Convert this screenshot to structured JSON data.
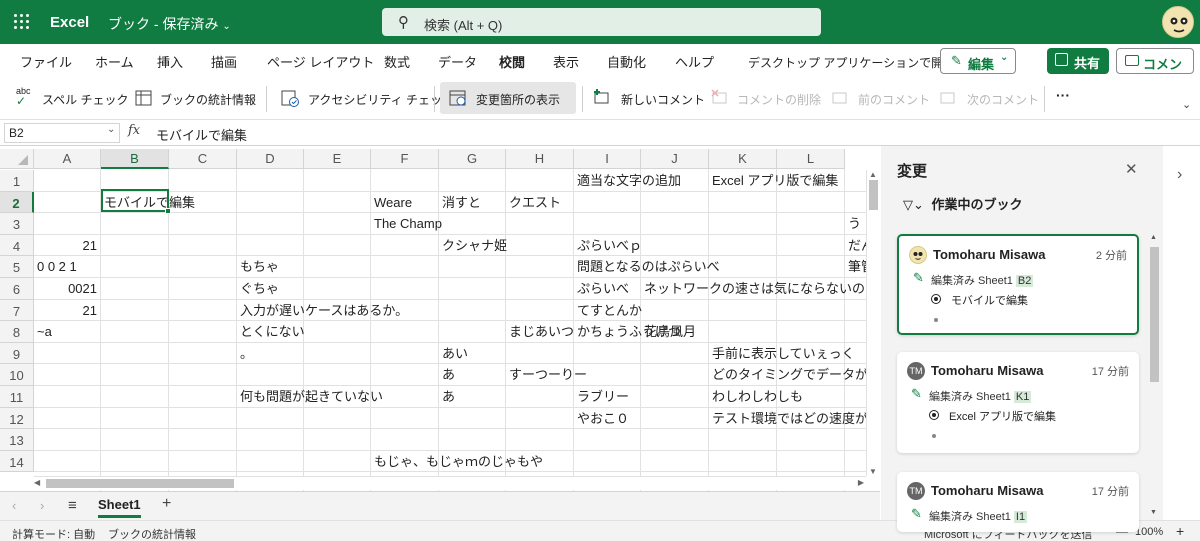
{
  "titlebar": {
    "app_name": "Excel",
    "doc_name": "ブック - 保存済み",
    "search_placeholder": "検索 (Alt + Q)"
  },
  "menu": {
    "tabs": [
      "ファイル",
      "ホーム",
      "挿入",
      "描画",
      "ページ レイアウト",
      "数式",
      "データ",
      "校閲",
      "表示",
      "自動化",
      "ヘルプ",
      "デスクトップ アプリケーションで開く"
    ],
    "active": "校閲",
    "edit_label": "編集",
    "share_label": "共有",
    "comment_label": "コメント"
  },
  "ribbon": {
    "spelling": "スペル チェック",
    "workbook_stats": "ブックの統計情報",
    "accessibility": "アクセシビリティ チェック",
    "show_changes": "変更箇所の表示",
    "new_comment": "新しいコメント",
    "delete_comment": "コメントの削除",
    "prev_comment": "前のコメント",
    "next_comment": "次のコメント",
    "more": "···"
  },
  "formula_bar": {
    "name_box": "B2",
    "fx": "fx",
    "content": "モバイルで編集"
  },
  "grid": {
    "columns": [
      "A",
      "B",
      "C",
      "D",
      "E",
      "F",
      "G",
      "H",
      "I",
      "J",
      "K",
      "L"
    ],
    "rows": [
      "1",
      "2",
      "3",
      "4",
      "5",
      "6",
      "7",
      "8",
      "9",
      "10",
      "11",
      "12",
      "13",
      "14"
    ],
    "cells": {
      "I1": "適当な文字の追加",
      "K1": "Excel アプリ版で編集",
      "B2": "モバイルで編集",
      "F2": "Weare",
      "G2": "消すと",
      "H2": "クエスト",
      "F3": "The Champ",
      "M3": "う",
      "A4": "21",
      "G4": "クシャナ姫",
      "I4": "ぷらいべｐ",
      "M4": "だん",
      "A5": "0 0 2 1",
      "D5": "もちゃ",
      "I5": "問題となるのはぷらいべ",
      "M5": "筆管",
      "A6": "0021",
      "D6": "ぐちゃ",
      "I6": "ぷらいべ",
      "J6": "ネットワークの速さは気にならないの",
      "A7": "21",
      "D7": "入力が遅いケースはあるか。",
      "I7": "てすとんか",
      "A8": "~a",
      "D8": "とくにない",
      "H8": "まじあいつ",
      "I8": "かちょうふうげつ",
      "J8": "花鳥風月",
      "D9": "。",
      "G9": "あい",
      "K9": "手前に表示していぇっく",
      "G10": "あ",
      "H10": "すーつーりー",
      "K10": "どのタイミングでデータが",
      "D11": "何も問題が起きていない",
      "G11": "あ",
      "I11": "ラブリー",
      "K11": "わしわしわしも",
      "I12": "やおこ０",
      "K12": "テスト環境ではどの速度が",
      "F14": "もじゃ、もじゃｍのじゃもや"
    }
  },
  "sheets": {
    "tabs": [
      "Sheet1"
    ],
    "add": "+"
  },
  "status": {
    "calc_mode": "計算モード: 自動",
    "stats": "ブックの統計情報",
    "feedback": "Microsoft にフィードバックを送信",
    "zoom_minus": "—",
    "zoom": "100%",
    "zoom_plus": "+"
  },
  "changes_pane": {
    "title": "変更",
    "filter": "作業中のブック",
    "cards": [
      {
        "initials": "",
        "name": "Tomoharu Misawa",
        "time": "2 分前",
        "action": "編集済み Sheet1",
        "ref": "B2",
        "value": "モバイルで編集"
      },
      {
        "initials": "TM",
        "name": "Tomoharu Misawa",
        "time": "17 分前",
        "action": "編集済み Sheet1",
        "ref": "K1",
        "value": "Excel アプリ版で編集"
      },
      {
        "initials": "TM",
        "name": "Tomoharu Misawa",
        "time": "17 分前",
        "action": "編集済み Sheet1",
        "ref": "I1",
        "value": ""
      }
    ]
  },
  "colors": {
    "brand": "#107c41",
    "accent_light": "#d6ead9"
  }
}
